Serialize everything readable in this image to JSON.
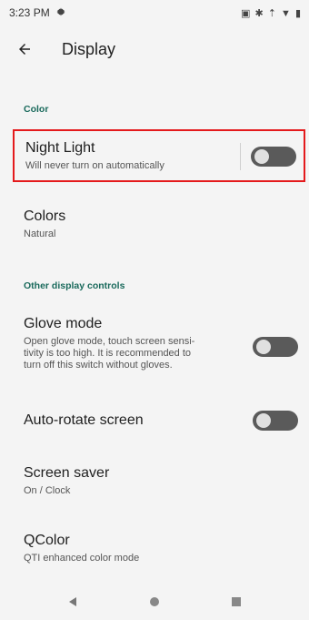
{
  "status_bar": {
    "time": "3:23 PM",
    "right_icons": "▣ ✱ ⇡ ▼ ▮"
  },
  "app_bar": {
    "title": "Display"
  },
  "sections": {
    "color_header": "Color",
    "other_header": "Other display controls"
  },
  "items": {
    "night_light": {
      "title": "Night Light",
      "subtitle": "Will never turn on automatically",
      "toggle_on": false
    },
    "colors": {
      "title": "Colors",
      "subtitle": "Natural"
    },
    "glove_mode": {
      "title": "Glove mode",
      "subtitle_line1": "Open glove mode, touch screen sensi-",
      "subtitle_line2": "tivity is too high. It is recommended to",
      "subtitle_line3": "turn off this switch without gloves.",
      "toggle_on": false
    },
    "auto_rotate": {
      "title": "Auto-rotate screen",
      "toggle_on": false
    },
    "screen_saver": {
      "title": "Screen saver",
      "subtitle": "On / Clock"
    },
    "qcolor": {
      "title": "QColor",
      "subtitle": "QTI enhanced color mode"
    }
  },
  "colors": {
    "accent": "#1a6a5c",
    "highlight": "#e41a1c",
    "toggle_off": "#5a5a5a"
  },
  "nav_icons": [
    "back-triangle",
    "home-circle",
    "recents-square"
  ]
}
